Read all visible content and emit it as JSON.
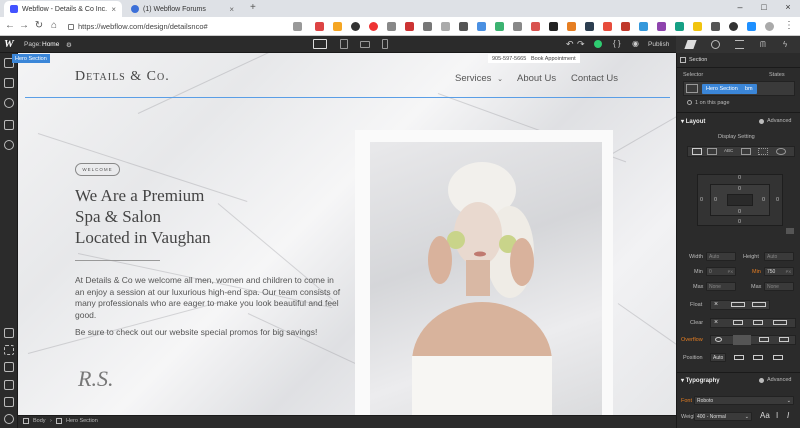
{
  "browser": {
    "tabs": [
      {
        "label": "Webflow - Details & Co Inc.",
        "active": true
      },
      {
        "label": "(1) Webflow Forums",
        "active": false
      }
    ],
    "url": "https://webflow.com/design/detailsnco#",
    "nav_icons": [
      "back-icon",
      "forward-icon",
      "reload-icon",
      "home-icon"
    ]
  },
  "designer": {
    "page_label": "Page:",
    "page_name": "Home",
    "publish_label": "Publish"
  },
  "canvas": {
    "selected_tag": "Hero Section",
    "logo": "Details & Co.",
    "nav": [
      "Services",
      "About Us",
      "Contact Us"
    ],
    "phone": "905-597-5665",
    "book": "Book Appointment",
    "welcome_pill": "WELCOME",
    "headline_lines": [
      "We Are a Premium",
      "Spa & Salon",
      "Located in Vaughan"
    ],
    "para1": "At Details & Co we welcome all men, women and children to come in an enjoy a session at our luxurious high-end spa. Our team consists of many professionals who are eager to make you look beautiful and feel good.",
    "para2": "Be sure to check out our website special promos for big savings!",
    "signature": "R.S."
  },
  "panel": {
    "section_label": "Section",
    "selector_label": "Selector",
    "states_label": "States",
    "class_chip": "Hero Section",
    "chip2": "bm",
    "on_page": "1 on this page",
    "layout_title": "Layout",
    "advanced": "Advanced",
    "display_setting": "Display Setting",
    "box_values": {
      "margin": "0",
      "padding": "0"
    },
    "width_label": "Width",
    "width_val": "Auto",
    "height_label": "Height",
    "height_val": "Auto",
    "min_label": "Min",
    "min_w": "0",
    "min_h": "750",
    "max_label": "Max",
    "max_w": "None",
    "max_h": "None",
    "unit": "PX",
    "float_label": "Float",
    "clear_label": "Clear",
    "overflow_label": "Overflow",
    "position_label": "Position",
    "position_val": "Auto",
    "typography_title": "Typography",
    "font_label": "Font",
    "font_val": "Roboto",
    "weight_label": "Weight",
    "weight_val": "400 - Normal"
  },
  "breadcrumb": [
    "Body",
    "Hero Section"
  ]
}
